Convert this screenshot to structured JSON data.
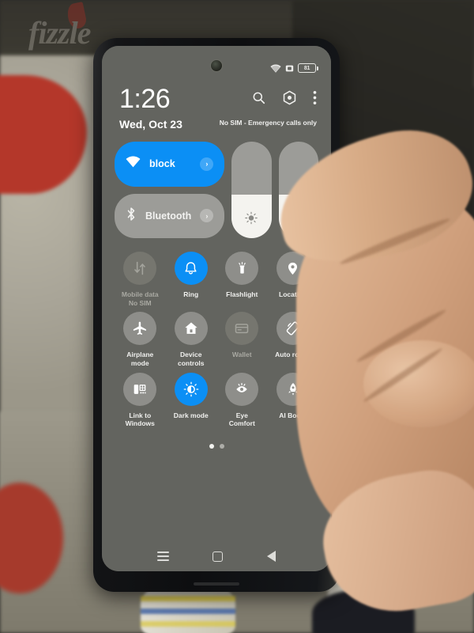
{
  "photo": {
    "watermark_text": "fizzle",
    "watermark_icon": "flame-logo"
  },
  "status_bar": {
    "wifi_icon": "wifi-icon",
    "vibrate_icon": "vibrate-icon",
    "battery_icon": "battery-icon",
    "battery_percent": "81"
  },
  "quick_settings": {
    "clock": {
      "time": "1:26",
      "date": "Wed, Oct 23"
    },
    "header_icons": [
      {
        "name": "search-icon",
        "label": "Search"
      },
      {
        "name": "settings-gear-icon",
        "label": "Settings"
      },
      {
        "name": "overflow-menu-icon",
        "label": "More options"
      }
    ],
    "carrier_status": "No SIM - Emergency calls only",
    "connectivity_tiles": [
      {
        "name": "wifi-tile",
        "label": "block",
        "icon": "wifi-icon",
        "state": "on",
        "chevron": "›"
      },
      {
        "name": "bluetooth-tile",
        "label": "Bluetooth",
        "icon": "bluetooth-icon",
        "state": "off",
        "chevron": "›"
      }
    ],
    "sliders": [
      {
        "name": "brightness-slider",
        "icon": "brightness-icon",
        "value": 45
      },
      {
        "name": "volume-slider",
        "icon": "volume-icon",
        "value": 45
      }
    ],
    "toggles": [
      {
        "name": "mobile-data-toggle",
        "label": "Mobile data\nNo SIM",
        "icon": "mobile-data-icon",
        "state": "disabled"
      },
      {
        "name": "ring-toggle",
        "label": "Ring",
        "icon": "bell-icon",
        "state": "active"
      },
      {
        "name": "flashlight-toggle",
        "label": "Flashlight",
        "icon": "flashlight-icon",
        "state": "off"
      },
      {
        "name": "location-toggle",
        "label": "Location",
        "icon": "location-pin-icon",
        "state": "off"
      },
      {
        "name": "airplane-mode-toggle",
        "label": "Airplane\nmode",
        "icon": "airplane-icon",
        "state": "off"
      },
      {
        "name": "device-controls-toggle",
        "label": "Device\ncontrols",
        "icon": "home-icon",
        "state": "off"
      },
      {
        "name": "wallet-toggle",
        "label": "Wallet",
        "icon": "wallet-icon",
        "state": "disabled"
      },
      {
        "name": "auto-rotate-toggle",
        "label": "Auto rotate",
        "icon": "rotate-icon",
        "state": "off"
      },
      {
        "name": "link-to-windows-toggle",
        "label": "Link to\nWindows",
        "icon": "link-windows-icon",
        "state": "off"
      },
      {
        "name": "dark-mode-toggle",
        "label": "Dark mode",
        "icon": "dark-mode-icon",
        "state": "active"
      },
      {
        "name": "eye-comfort-toggle",
        "label": "Eye\nComfort",
        "icon": "eye-icon",
        "state": "off"
      },
      {
        "name": "ai-boost-toggle",
        "label": "AI Boost",
        "icon": "rocket-icon",
        "state": "off"
      }
    ],
    "page_dots": {
      "count": 2,
      "active_index": 0
    }
  },
  "nav_bar": [
    {
      "name": "recents-button",
      "icon": "recents-icon"
    },
    {
      "name": "home-button",
      "icon": "home-square-icon"
    },
    {
      "name": "back-button",
      "icon": "back-triangle-icon"
    }
  ],
  "colors": {
    "accent_blue": "#0b8ff5",
    "tile_gray": "#9c9c98",
    "screen_bg": "#63645f"
  }
}
